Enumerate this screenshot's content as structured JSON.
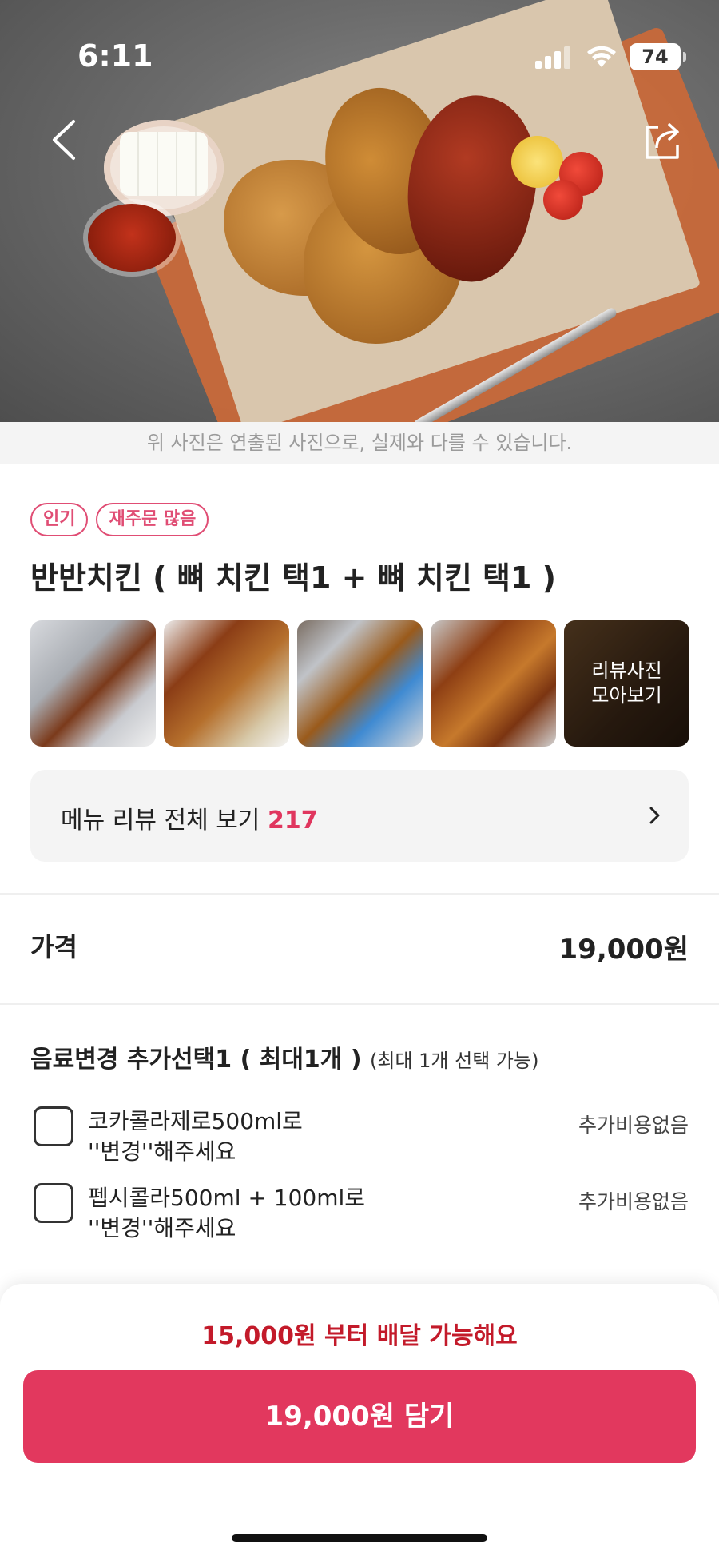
{
  "status_bar": {
    "time": "6:11",
    "battery": "74"
  },
  "hero": {
    "photo_note": "위 사진은 연출된 사진으로, 실제와 다를 수 있습니다."
  },
  "badges": [
    "인기",
    "재주문 많음"
  ],
  "menu": {
    "title": "반반치킨 ( 뼈 치킨 택1 + 뼈 치킨 택1 )"
  },
  "review_photos": {
    "more_label": "리뷰사진\n모아보기"
  },
  "review_link": {
    "label": "메뉴 리뷰 전체 보기",
    "count": "217"
  },
  "price": {
    "label": "가격",
    "value": "19,000원"
  },
  "options": {
    "title": "음료변경 추가선택1 ( 최대1개 )",
    "subtitle": "(최대 1개 선택 가능)",
    "items": [
      {
        "label": "코카콜라제로500ml로\n''변경''해주세요",
        "cost": "추가비용없음",
        "checked": false
      },
      {
        "label": "펩시콜라500ml + 100ml로\n''변경''해주세요",
        "cost": "추가비용없음",
        "checked": false
      }
    ]
  },
  "bottom": {
    "min_delivery": "15,000원 부터 배달 가능해요",
    "add_button": "19,000원 담기"
  },
  "colors": {
    "accent": "#e2385e",
    "badge": "#e04d74",
    "warning": "#c31a2a"
  }
}
